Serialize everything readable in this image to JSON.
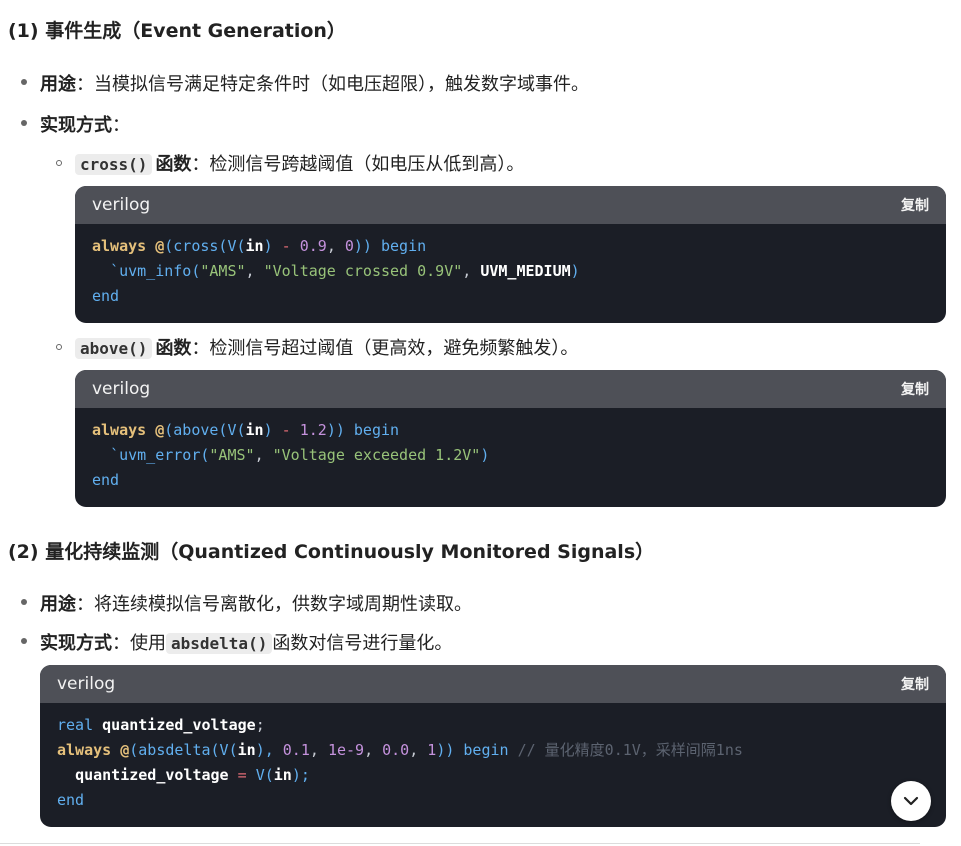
{
  "section1": {
    "heading": "(1) 事件生成（Event Generation）",
    "purpose_label": "用途",
    "purpose_text": "：当模拟信号满足特定条件时（如电压超限），触发数字域事件。",
    "impl_label": "实现方式",
    "impl_text": "：",
    "sub1": {
      "code": "cross()",
      "label": "函数",
      "text": "：检测信号跨越阈值（如电压从低到高）。",
      "lang": "verilog",
      "copy": "复制",
      "line1": {
        "kw": "always",
        "at": "@",
        "p1": "(cross(V(",
        "in": "in",
        "p2": ")",
        "minus": "-",
        "num1": "0.9",
        "comma": ",",
        "num2": "0",
        "p3": "))",
        "begin": "begin"
      },
      "line2": {
        "fn": "`uvm_info(",
        "s1": "\"AMS\"",
        "s2": "\"Voltage crossed 0.9V\"",
        "c": "UVM_MEDIUM",
        "end": ")"
      },
      "line3": "end"
    },
    "sub2": {
      "code": "above()",
      "label": "函数",
      "text": "：检测信号超过阈值（更高效，避免频繁触发）。",
      "lang": "verilog",
      "copy": "复制",
      "line1": {
        "kw": "always",
        "at": "@",
        "p1": "(above(V(",
        "in": "in",
        "p2": ")",
        "minus": "-",
        "num1": "1.2",
        "p3": "))",
        "begin": "begin"
      },
      "line2": {
        "fn": "`uvm_error(",
        "s1": "\"AMS\"",
        "s2": "\"Voltage exceeded 1.2V\"",
        "end": ")"
      },
      "line3": "end"
    }
  },
  "section2": {
    "heading": "(2) 量化持续监测（Quantized Continuously Monitored Signals）",
    "purpose_label": "用途",
    "purpose_text": "：将连续模拟信号离散化，供数字域周期性读取。",
    "impl_label": "实现方式",
    "impl_text_a": "：使用",
    "impl_code": "absdelta()",
    "impl_text_b": "函数对信号进行量化。",
    "block": {
      "lang": "verilog",
      "copy": "复制",
      "line1": {
        "type": "real",
        "name": "quantized_voltage",
        "semi": ";"
      },
      "line2": {
        "kw": "always",
        "at": "@",
        "p1": "(absdelta(V(",
        "in": "in",
        "p2": "),",
        "n1": "0.1",
        "n2": "1e-9",
        "n3": "0.0",
        "n4": "1",
        "p3": "))",
        "begin": "begin",
        "comment": "// 量化精度0.1V，采样间隔1ns"
      },
      "line3": {
        "name": "quantized_voltage",
        "eq": "=",
        "v": "V(",
        "in": "in",
        "end": ");"
      },
      "line4": "end"
    }
  },
  "scroll_button_icon": "chevron-down-icon"
}
